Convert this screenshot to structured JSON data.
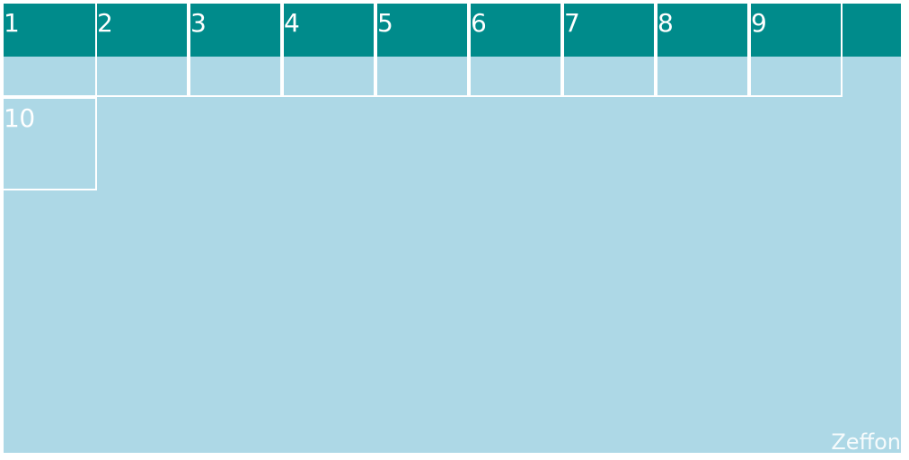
{
  "colors": {
    "teal": "#008b8b",
    "light_blue": "#add8e6",
    "border": "#ffffff"
  },
  "tiles": [
    "1",
    "2",
    "3",
    "4",
    "5",
    "6",
    "7",
    "8",
    "9",
    "10"
  ],
  "brand": "Zeffon"
}
